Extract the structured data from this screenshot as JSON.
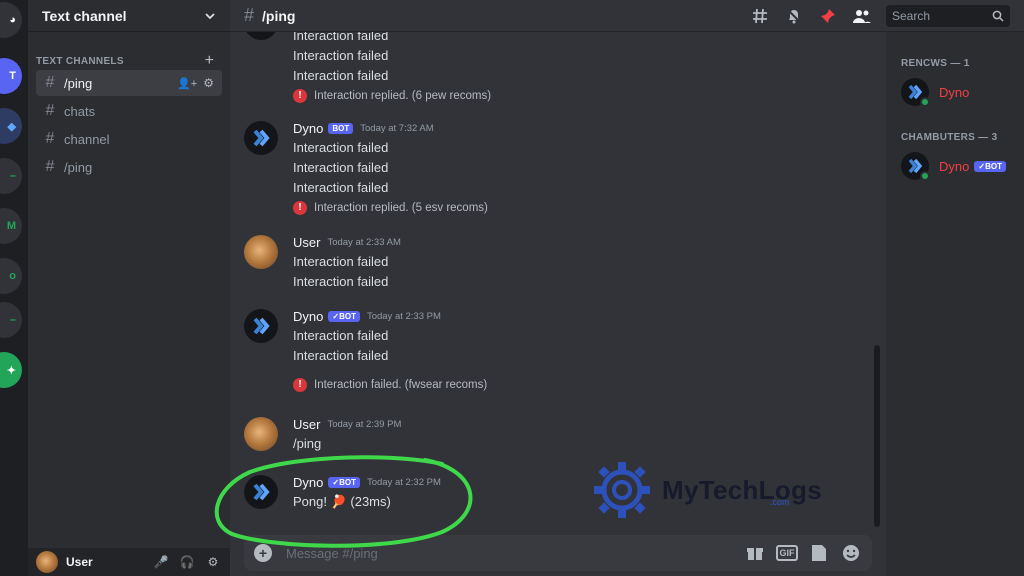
{
  "rail": {
    "servers": [
      "T",
      "",
      "",
      "M",
      "",
      "",
      ""
    ]
  },
  "sidebar": {
    "title": "Text channel",
    "category": "TEXT CHANNELS",
    "channels": [
      {
        "name": "/ping",
        "active": true
      },
      {
        "name": "chats",
        "active": false
      },
      {
        "name": "channel",
        "active": false
      },
      {
        "name": "/ping",
        "active": false
      }
    ],
    "user": {
      "name": "User"
    }
  },
  "header": {
    "channel": "/ping",
    "search_placeholder": "Search"
  },
  "messages": [
    {
      "author": "",
      "bot": false,
      "time": "",
      "lines": [
        "Interaction failed",
        "Interaction failed",
        "Interaction failed"
      ],
      "error": "Interaction replied. (6 pew recoms)"
    },
    {
      "author": "Dyno",
      "bot": true,
      "bot_label": "BOT",
      "time": "Today at 7:32 AM",
      "lines": [
        "Interaction failed",
        "Interaction failed",
        "Interaction failed"
      ],
      "error": "Interaction replied. (5 esv recoms)"
    },
    {
      "author": "User",
      "bot": false,
      "time": "Today at 2:33 AM",
      "lines": [
        "Interaction failed",
        "Interaction failed"
      ]
    },
    {
      "author": "Dyno",
      "bot": true,
      "bot_label": "✓BOT",
      "time": "Today at 2:33 PM",
      "lines": [
        "Interaction failed",
        "Interaction failed"
      ],
      "error": "Interaction failed. (fwsear recoms)"
    },
    {
      "author": "User",
      "bot": false,
      "time": "Today at 2:39 PM",
      "lines": [
        "/ping"
      ]
    },
    {
      "author": "Dyno",
      "bot": true,
      "bot_label": "✓BOT",
      "time": "Today at 2:32 PM",
      "lines": [
        "Pong! 🏓 (23ms)"
      ]
    }
  ],
  "composer": {
    "placeholder": "Message #/ping",
    "gif_label": "GIF"
  },
  "members": {
    "groups": [
      {
        "label": "RENCWS — 1",
        "members": [
          {
            "name": "Dyno",
            "bot_label": ""
          }
        ]
      },
      {
        "label": "CHAMBUTERS — 3",
        "members": [
          {
            "name": "Dyno",
            "bot_label": "✓BOT"
          }
        ]
      }
    ]
  },
  "watermark": {
    "brand": "MyTechLogs",
    "sub": ".com"
  },
  "colors": {
    "blurple": "#5865f2",
    "danger": "#da373c",
    "online": "#23a559",
    "highlight": "#3fd84a"
  }
}
